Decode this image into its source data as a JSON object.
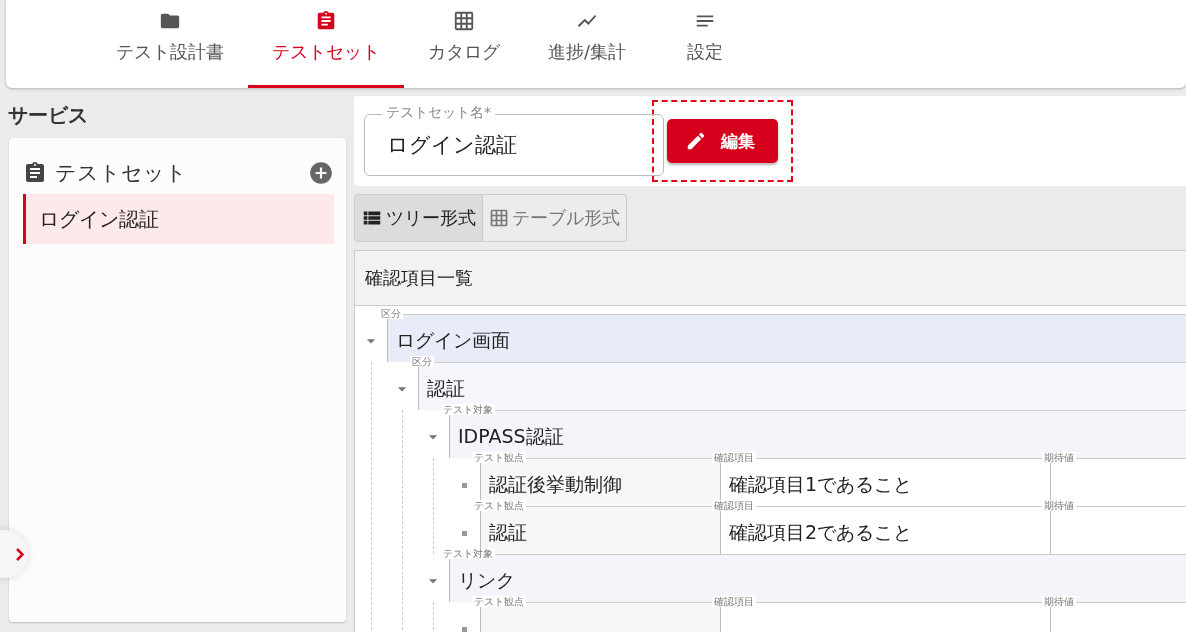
{
  "nav": {
    "tabs": [
      {
        "label": "テスト設計書",
        "kind": "folder",
        "selected": false
      },
      {
        "label": "テストセット",
        "kind": "clipboard",
        "selected": true
      },
      {
        "label": "カタログ",
        "kind": "grid",
        "selected": false
      },
      {
        "label": "進捗/集計",
        "kind": "chart",
        "selected": false
      },
      {
        "label": "設定",
        "kind": "lines",
        "selected": false
      }
    ]
  },
  "sidebar": {
    "title": "サービス",
    "section": {
      "label": "テストセット",
      "items": [
        {
          "label": "ログイン認証",
          "selected": true
        }
      ]
    }
  },
  "header": {
    "name_field": {
      "label": "テストセット名*",
      "value": "ログイン認証"
    },
    "edit_button": "編集",
    "highlighted": true
  },
  "view_toggle": [
    {
      "label": "ツリー形式",
      "kind": "list",
      "selected": true
    },
    {
      "label": "テーブル形式",
      "kind": "grid",
      "selected": false
    }
  ],
  "panel": {
    "title": "確認項目一覧",
    "tree": [
      {
        "kind": "group",
        "label": "区分",
        "value": "ログイン画面",
        "expanded": true,
        "children": [
          {
            "kind": "group",
            "label": "区分",
            "value": "認証",
            "expanded": true,
            "children": [
              {
                "kind": "target",
                "label": "テスト対象",
                "value": "IDPASS認証",
                "expanded": true,
                "children": [
                  {
                    "kind": "check",
                    "fields": [
                      {
                        "label": "テスト観点",
                        "value": "認証後挙動制御"
                      },
                      {
                        "label": "確認項目",
                        "value": "確認項目1であること"
                      },
                      {
                        "label": "期待値"
                      }
                    ]
                  },
                  {
                    "kind": "check",
                    "fields": [
                      {
                        "label": "テスト観点",
                        "value": "認証"
                      },
                      {
                        "label": "確認項目",
                        "value": "確認項目2であること"
                      },
                      {
                        "label": "期待値"
                      }
                    ]
                  }
                ]
              },
              {
                "kind": "target",
                "label": "テスト対象",
                "value": "リンク",
                "expanded": true,
                "children": [
                  {
                    "kind": "check",
                    "fields": [
                      {
                        "label": "テスト観点"
                      },
                      {
                        "label": "確認項目"
                      },
                      {
                        "label": "期待値"
                      }
                    ]
                  }
                ]
              }
            ]
          }
        ]
      }
    ]
  }
}
